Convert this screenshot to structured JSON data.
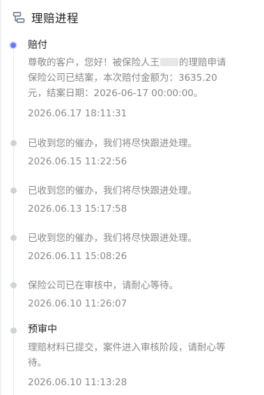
{
  "header": {
    "icon": "flow-icon",
    "title": "理赔进程"
  },
  "colors": {
    "active_dot": "#6677f0",
    "inactive_dot": "#cfd2d8",
    "timeline_line": "#e4e6ea"
  },
  "events": [
    {
      "title": "赔付",
      "body_lines": [
        {
          "pre": "尊敬的客户，您好！被保险人王",
          "post": "的理赔申请"
        },
        {
          "text": "保险公司已结案，本次赔付金额为：3635.20"
        },
        {
          "text": "元，结案日期：2026-06-17 00:00:00。"
        }
      ],
      "time": "2026.06.17 18:11:31",
      "active": true
    },
    {
      "body": "已收到您的催办，我们将尽快跟进处理。",
      "time": "2026.06.15 11:22:56"
    },
    {
      "body": "已收到您的催办，我们将尽快跟进处理。",
      "time": "2026.06.13 15:17:58"
    },
    {
      "body": "已收到您的催办，我们将尽快跟进处理。",
      "time": "2026.06.11 15:08:26"
    },
    {
      "body": "保险公司已在审核中，请耐心等待。",
      "time": "2026.06.10 11:26:07"
    },
    {
      "title": "预审中",
      "body_lines": [
        {
          "text": "理赔材料已提交，案件进入审核阶段，请耐心等"
        },
        {
          "text": "待。"
        }
      ],
      "time": "2026.06.10 11:13:28"
    }
  ]
}
